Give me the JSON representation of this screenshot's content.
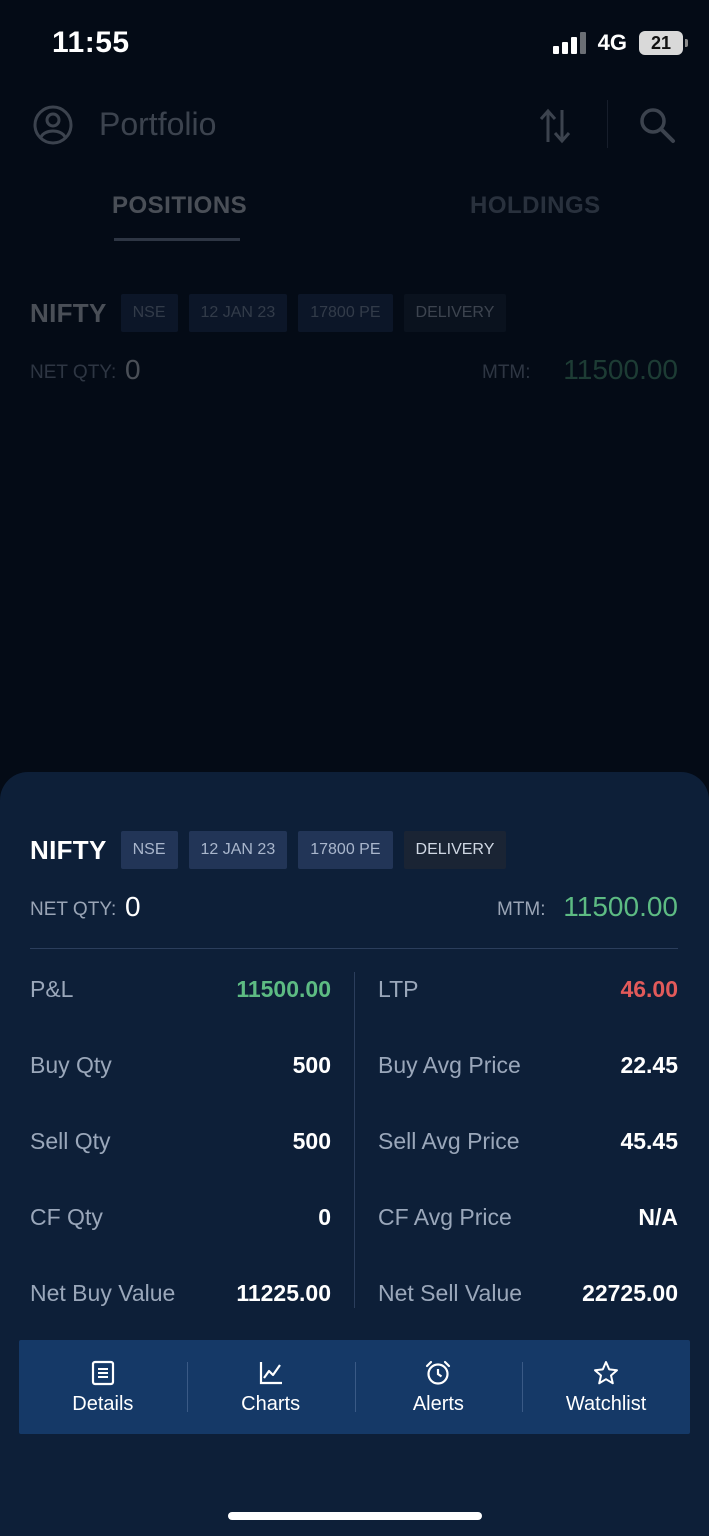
{
  "status_bar": {
    "time": "11:55",
    "network": "4G",
    "battery": "21"
  },
  "header": {
    "title": "Portfolio"
  },
  "tabs": [
    {
      "label": "POSITIONS"
    },
    {
      "label": "HOLDINGS"
    }
  ],
  "position": {
    "name": "NIFTY",
    "exchange": "NSE",
    "expiry": "12 JAN 23",
    "strike": "17800 PE",
    "product": "DELIVERY",
    "net_qty_label": "NET QTY:",
    "net_qty": "0",
    "mtm_label": "MTM:",
    "mtm": "11500.00"
  },
  "details_left": [
    {
      "label": "P&L",
      "value": "11500.00"
    },
    {
      "label": "Buy Qty",
      "value": "500"
    },
    {
      "label": "Sell Qty",
      "value": "500"
    },
    {
      "label": "CF Qty",
      "value": "0"
    },
    {
      "label": "Net Buy Value",
      "value": "11225.00"
    }
  ],
  "details_right": [
    {
      "label": "LTP",
      "value": "46.00"
    },
    {
      "label": "Buy Avg Price",
      "value": "22.45"
    },
    {
      "label": "Sell Avg Price",
      "value": "45.45"
    },
    {
      "label": "CF Avg Price",
      "value": "N/A"
    },
    {
      "label": "Net Sell Value",
      "value": "22725.00"
    }
  ],
  "actions": [
    {
      "label": "Details",
      "icon": "document-icon"
    },
    {
      "label": "Charts",
      "icon": "chart-icon"
    },
    {
      "label": "Alerts",
      "icon": "alarm-clock-icon"
    },
    {
      "label": "Watchlist",
      "icon": "star-icon"
    }
  ],
  "colors": {
    "profit": "#5dbb83",
    "loss": "#e25a5a",
    "sheet": "#0d1f38",
    "action_bar": "#153967"
  }
}
